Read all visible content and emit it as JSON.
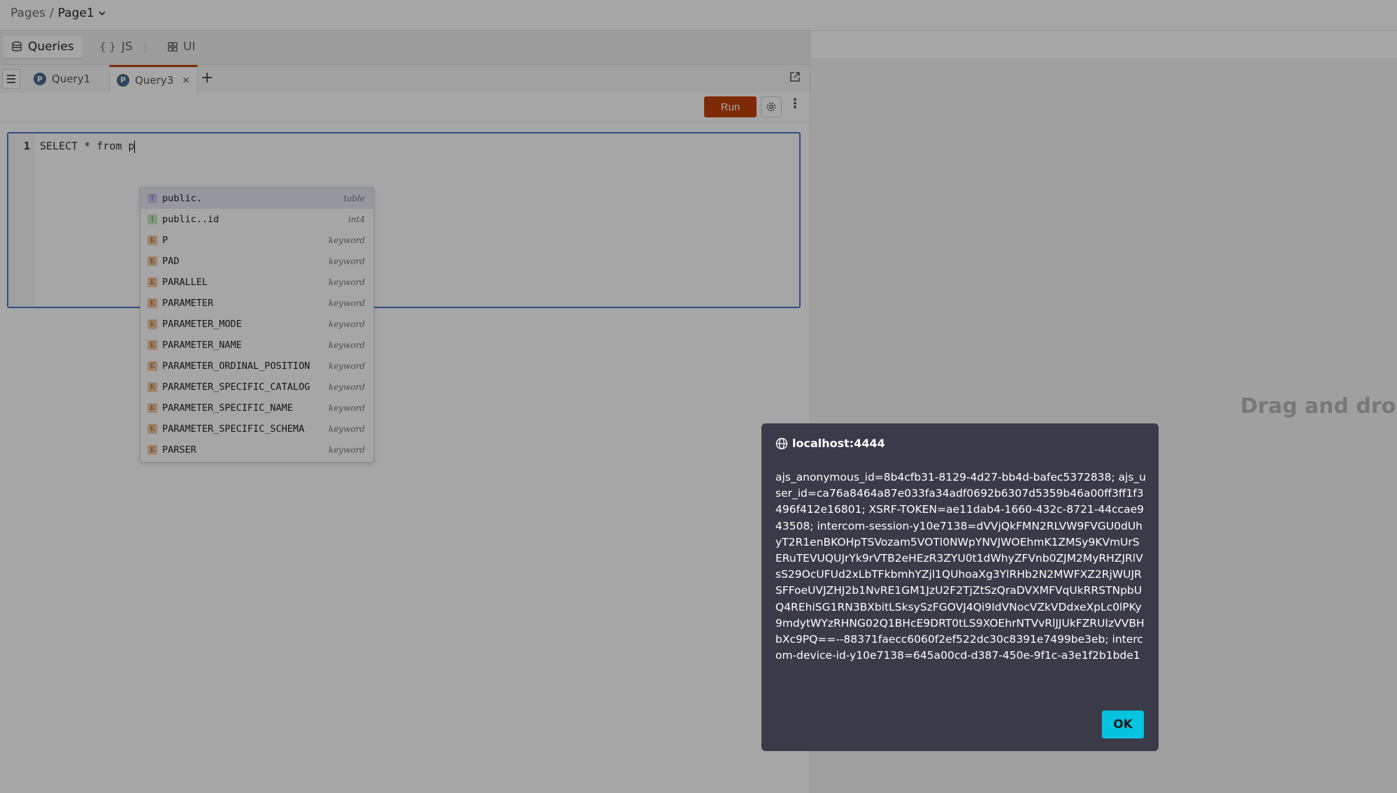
{
  "breadcrumb": {
    "root": "Pages",
    "separator": "/",
    "current": "Page1"
  },
  "mode_tabs": [
    {
      "label": "Queries",
      "icon": "database-icon"
    },
    {
      "label": "JS",
      "icon": "braces-icon",
      "glyph": "{ }"
    },
    {
      "label": "UI",
      "icon": "widgets-icon"
    }
  ],
  "query_tabs": [
    {
      "label": "Query1"
    },
    {
      "label": "Query3",
      "close": "×"
    }
  ],
  "add_tab": "+",
  "toolbar": {
    "run_label": "Run"
  },
  "editor": {
    "line_number": "1",
    "code": "SELECT * from p"
  },
  "autocomplete": [
    {
      "badge": "T",
      "label": "public.",
      "type": "table"
    },
    {
      "badge": "I",
      "label": "public..id",
      "type": "int4"
    },
    {
      "badge": "K",
      "label": "P",
      "type": "keyword"
    },
    {
      "badge": "K",
      "label": "PAD",
      "type": "keyword"
    },
    {
      "badge": "K",
      "label": "PARALLEL",
      "type": "keyword"
    },
    {
      "badge": "K",
      "label": "PARAMETER",
      "type": "keyword"
    },
    {
      "badge": "K",
      "label": "PARAMETER_MODE",
      "type": "keyword"
    },
    {
      "badge": "K",
      "label": "PARAMETER_NAME",
      "type": "keyword"
    },
    {
      "badge": "K",
      "label": "PARAMETER_ORDINAL_POSITION",
      "type": "keyword"
    },
    {
      "badge": "K",
      "label": "PARAMETER_SPECIFIC_CATALOG",
      "type": "keyword"
    },
    {
      "badge": "K",
      "label": "PARAMETER_SPECIFIC_NAME",
      "type": "keyword"
    },
    {
      "badge": "K",
      "label": "PARAMETER_SPECIFIC_SCHEMA",
      "type": "keyword"
    },
    {
      "badge": "K",
      "label": "PARSER",
      "type": "keyword"
    }
  ],
  "canvas": {
    "placeholder": "Drag and drop a"
  },
  "dialog": {
    "title": "localhost:4444",
    "message": "ajs_anonymous_id=8b4cfb31-8129-4d27-bb4d-bafec5372838; ajs_user_id=ca76a8464a87e033fa34adf0692b6307d5359b46a00ff3ff1f3496f412e16801; XSRF-TOKEN=ae11dab4-1660-432c-8721-44ccae943508; intercom-session-y10e7138=dVVjQkFMN2RLVW9FVGU0dUhyT2R1enBKOHpTSVozam5VOTl0NWpYNVJWOEhmK1ZMSy9KVmUrSERuTEVUQUJrYk9rVTB2eHEzR3ZYU0t1dWhyZFVnb0ZJM2MyRHZJRlVsS29OcUFUd2xLbTFkbmhYZjl1QUhoaXg3YlRHb2N2MWFXZ2RjWUJRSFFoeUVJZHJ2b1NvRE1GM1JzU2F2TjZtSzQraDVXMFVqUkRRSTNpbUQ4REhiSG1RN3BXbitLSksySzFGOVJ4Qi9IdVNocVZkVDdxeXpLc0lPKy9mdytWYzRHNG02Q1BHcE9DRT0tLS9XOEhrNTVvRlJJUkFZRUIzVVBHbXc9PQ==--88371faecc6060f2ef522dc30c8391e7499be3eb; intercom-device-id-y10e7138=645a00cd-d387-450e-9f1c-a3e1f2b1bde1",
    "ok_label": "OK"
  },
  "colors": {
    "run": "#c2410c",
    "ok": "#06c3e0",
    "dialog_bg": "#3b3a48",
    "editor_border": "#4a77c8"
  }
}
